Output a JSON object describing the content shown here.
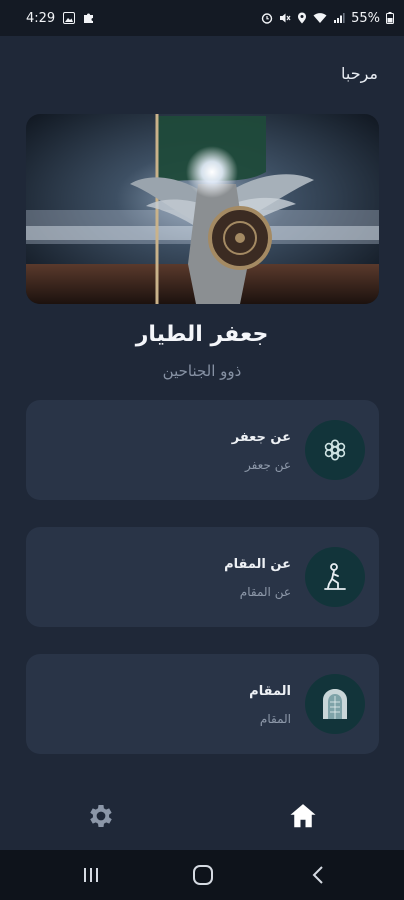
{
  "status_bar": {
    "time": "4:29",
    "battery": "55%"
  },
  "header": {
    "greeting": "مرحبا"
  },
  "profile": {
    "name": "جعفر الطيار",
    "subtitle": "ذوو الجناحين"
  },
  "cards": [
    {
      "title": "عن جعفر",
      "subtitle": "عن جعفر",
      "icon": "flower-emblem-icon"
    },
    {
      "title": "عن المقام",
      "subtitle": "عن المقام",
      "icon": "kneeling-figure-icon"
    },
    {
      "title": "المقام",
      "subtitle": "المقام",
      "icon": "shrine-door-icon"
    }
  ],
  "bottom_nav": {
    "items": [
      "settings-icon",
      "home-icon"
    ],
    "active": "home"
  },
  "colors": {
    "background": "#1f2838",
    "card": "#293447",
    "icon_circle": "#12343a",
    "accent_teal": "#6fb5b5"
  }
}
